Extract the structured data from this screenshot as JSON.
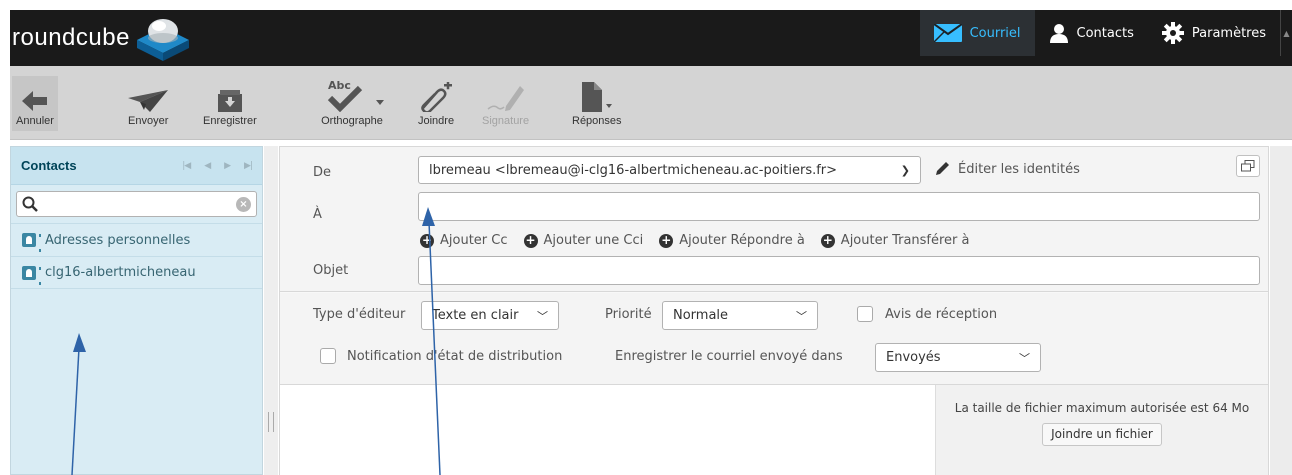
{
  "app": {
    "logo_text": "roundcube"
  },
  "taskbar": [
    {
      "label": "Courriel",
      "icon": "mail-icon",
      "active": true
    },
    {
      "label": "Contacts",
      "icon": "contacts-icon",
      "active": false
    },
    {
      "label": "Paramètres",
      "icon": "gear-icon",
      "active": false
    }
  ],
  "toolbar": {
    "cancel": "Annuler",
    "send": "Envoyer",
    "save": "Enregistrer",
    "spell": "Orthographe",
    "spell_icon_text": "Abc",
    "attach": "Joindre",
    "signature": "Signature",
    "responses": "Réponses"
  },
  "sidebar": {
    "title": "Contacts",
    "search_value": "",
    "addressbooks": [
      "Adresses personnelles",
      "clg16-albertmicheneau"
    ]
  },
  "compose": {
    "from_label": "De",
    "from_value": "lbremeau <lbremeau@i-clg16-albertmicheneau.ac-poitiers.fr>",
    "edit_identities": "Éditer les identités",
    "to_label": "À",
    "to_value": "",
    "add_cc": "Ajouter Cc",
    "add_bcc": "Ajouter une Cci",
    "add_replyto": "Ajouter Répondre à",
    "add_followupto": "Ajouter Transférer à",
    "subject_label": "Objet",
    "subject_value": ""
  },
  "options": {
    "editor_label": "Type d'éditeur",
    "editor_value": "Texte en clair",
    "priority_label": "Priorité",
    "priority_value": "Normale",
    "receipt_label": "Avis de réception",
    "receipt_checked": false,
    "dsn_label": "Notification d'état de distribution",
    "dsn_checked": false,
    "store_label": "Enregistrer le courriel envoyé dans",
    "store_value": "Envoyés"
  },
  "attachments": {
    "max_size_text": "La taille de fichier maximum autorisée est 64 Mo",
    "attach_button": "Joindre un fichier"
  },
  "colors": {
    "topbar": "#1a1a1a",
    "active_task": "#37beff",
    "sidebar_bg": "#d9ecf4",
    "annotation_arrow": "#2e63a8"
  }
}
